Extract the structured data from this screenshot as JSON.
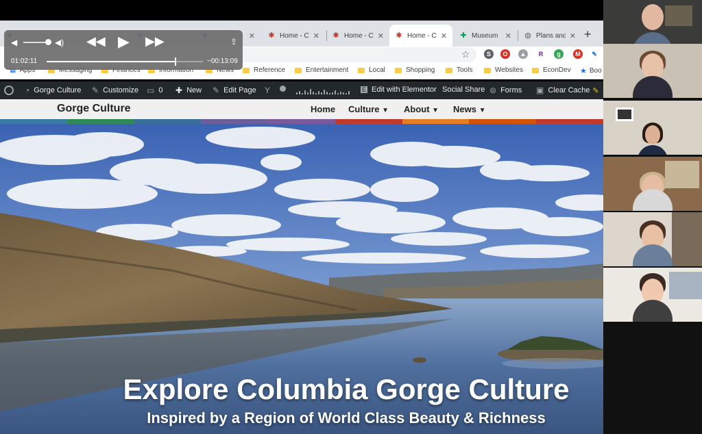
{
  "browser": {
    "tabs": [
      {
        "title": "",
        "icon": "red-app-icon"
      },
      {
        "title": "",
        "icon": "blue-app-icon"
      },
      {
        "title": "",
        "icon": "blue-app-icon"
      },
      {
        "title": "Home - C",
        "icon": "pinwheel-icon"
      },
      {
        "title": "Home - C",
        "icon": "pinwheel-icon"
      },
      {
        "title": "Home - C",
        "icon": "pinwheel-icon",
        "active": true
      },
      {
        "title": "Museum",
        "icon": "sheets-icon"
      },
      {
        "title": "Plans and",
        "icon": "globe-icon"
      }
    ],
    "bookmarks": [
      "Apps",
      "Messaging",
      "Finances",
      "Information",
      "News",
      "Reference",
      "Entertainment",
      "Local",
      "Shopping",
      "Tools",
      "Websites",
      "EconDev",
      "Boo"
    ]
  },
  "wp_admin": {
    "site": "Gorge Culture",
    "customize": "Customize",
    "comments": "0",
    "new": "New",
    "edit_page": "Edit Page",
    "elementor": "Edit with Elementor",
    "social": "Social Share",
    "forms": "Forms",
    "cache": "Clear Cache"
  },
  "site": {
    "title": "Gorge Culture",
    "nav": [
      "Home",
      "Culture",
      "About",
      "News"
    ],
    "brand_colors": [
      "#3a7ca5",
      "#2e8b57",
      "#3a6e9a",
      "#6b5e9b",
      "#7a5a9a",
      "#c0392b",
      "#e67e22",
      "#d35400",
      "#c0392b"
    ]
  },
  "hero": {
    "title": "Explore Columbia Gorge Culture",
    "subtitle": "Inspired by a Region of World Class Beauty & Richness"
  },
  "player": {
    "elapsed": "01:02:11",
    "remaining": "−00:13:09",
    "progress": 0.826,
    "volume": 0.85
  },
  "participants": [
    "participant-1",
    "participant-2",
    "participant-3",
    "participant-4",
    "participant-5",
    "participant-6"
  ]
}
